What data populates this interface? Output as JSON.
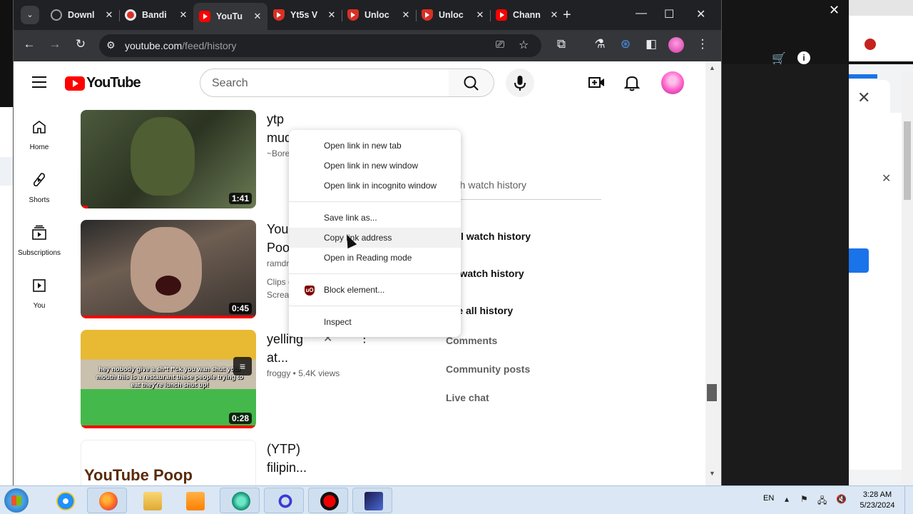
{
  "browser": {
    "tabs": [
      {
        "label": "Downl",
        "icon": "globe-icon"
      },
      {
        "label": "Bandi",
        "icon": "bandicam-icon"
      },
      {
        "label": "YouTu",
        "icon": "youtube-icon",
        "active": true
      },
      {
        "label": "Yt5s V",
        "icon": "adblock-shield-icon"
      },
      {
        "label": "Unloc",
        "icon": "adblock-shield-icon"
      },
      {
        "label": "Unloc",
        "icon": "adblock-shield-icon"
      },
      {
        "label": "Chann",
        "icon": "youtube-icon"
      }
    ],
    "url_host": "youtube.com",
    "url_path": "/feed/history"
  },
  "youtube": {
    "logo_text": "YouTube",
    "search_placeholder": "Search",
    "guide": [
      {
        "label": "Home",
        "icon": "home-icon"
      },
      {
        "label": "Shorts",
        "icon": "shorts-icon"
      },
      {
        "label": "Subscriptions",
        "icon": "subscriptions-icon"
      },
      {
        "label": "You",
        "icon": "you-icon"
      }
    ],
    "videos": [
      {
        "title_line1": "ytp",
        "title_line2": "mud",
        "meta": "~Bore",
        "duration": "1:41",
        "watched": 0.04
      },
      {
        "title_line1": "You",
        "title_line2": "Poo",
        "meta_line1": "ramdr",
        "meta_line2": "Clips c",
        "meta_line3": "Screar",
        "duration": "0:45",
        "watched": 1.0
      },
      {
        "title_line1": "yelling",
        "title_line2": "at...",
        "meta": "froggy • 5.4K views",
        "duration": "0:28",
        "watched": 1.0,
        "caption": "hey nobody give a sh*t f*ck you wan shut your mouth this is a restaurant these people trying to eat they're lunch shut up!"
      },
      {
        "title_line1": "(YTP)",
        "title_line2": "filipin...",
        "thumb_text": "YouTube Poop"
      }
    ],
    "side_panel": {
      "search_placeholder": "rch watch history",
      "links": [
        "r all watch history",
        "se watch history",
        "age all history"
      ],
      "history_types": [
        "Comments",
        "Community posts",
        "Live chat"
      ]
    }
  },
  "context_menu": {
    "items": [
      "Open link in new tab",
      "Open link in new window",
      "Open link in incognito window",
      "Save link as...",
      "Copy link address",
      "Open in Reading mode",
      "Block element...",
      "Inspect"
    ],
    "hovered": "Copy link address"
  },
  "taskbar": {
    "lang": "EN",
    "time": "3:28 AM",
    "date": "5/23/2024"
  },
  "colors": {
    "youtube_red": "#ff0000",
    "chrome_dark": "#202124",
    "taskbar": "#dbe7f4"
  }
}
